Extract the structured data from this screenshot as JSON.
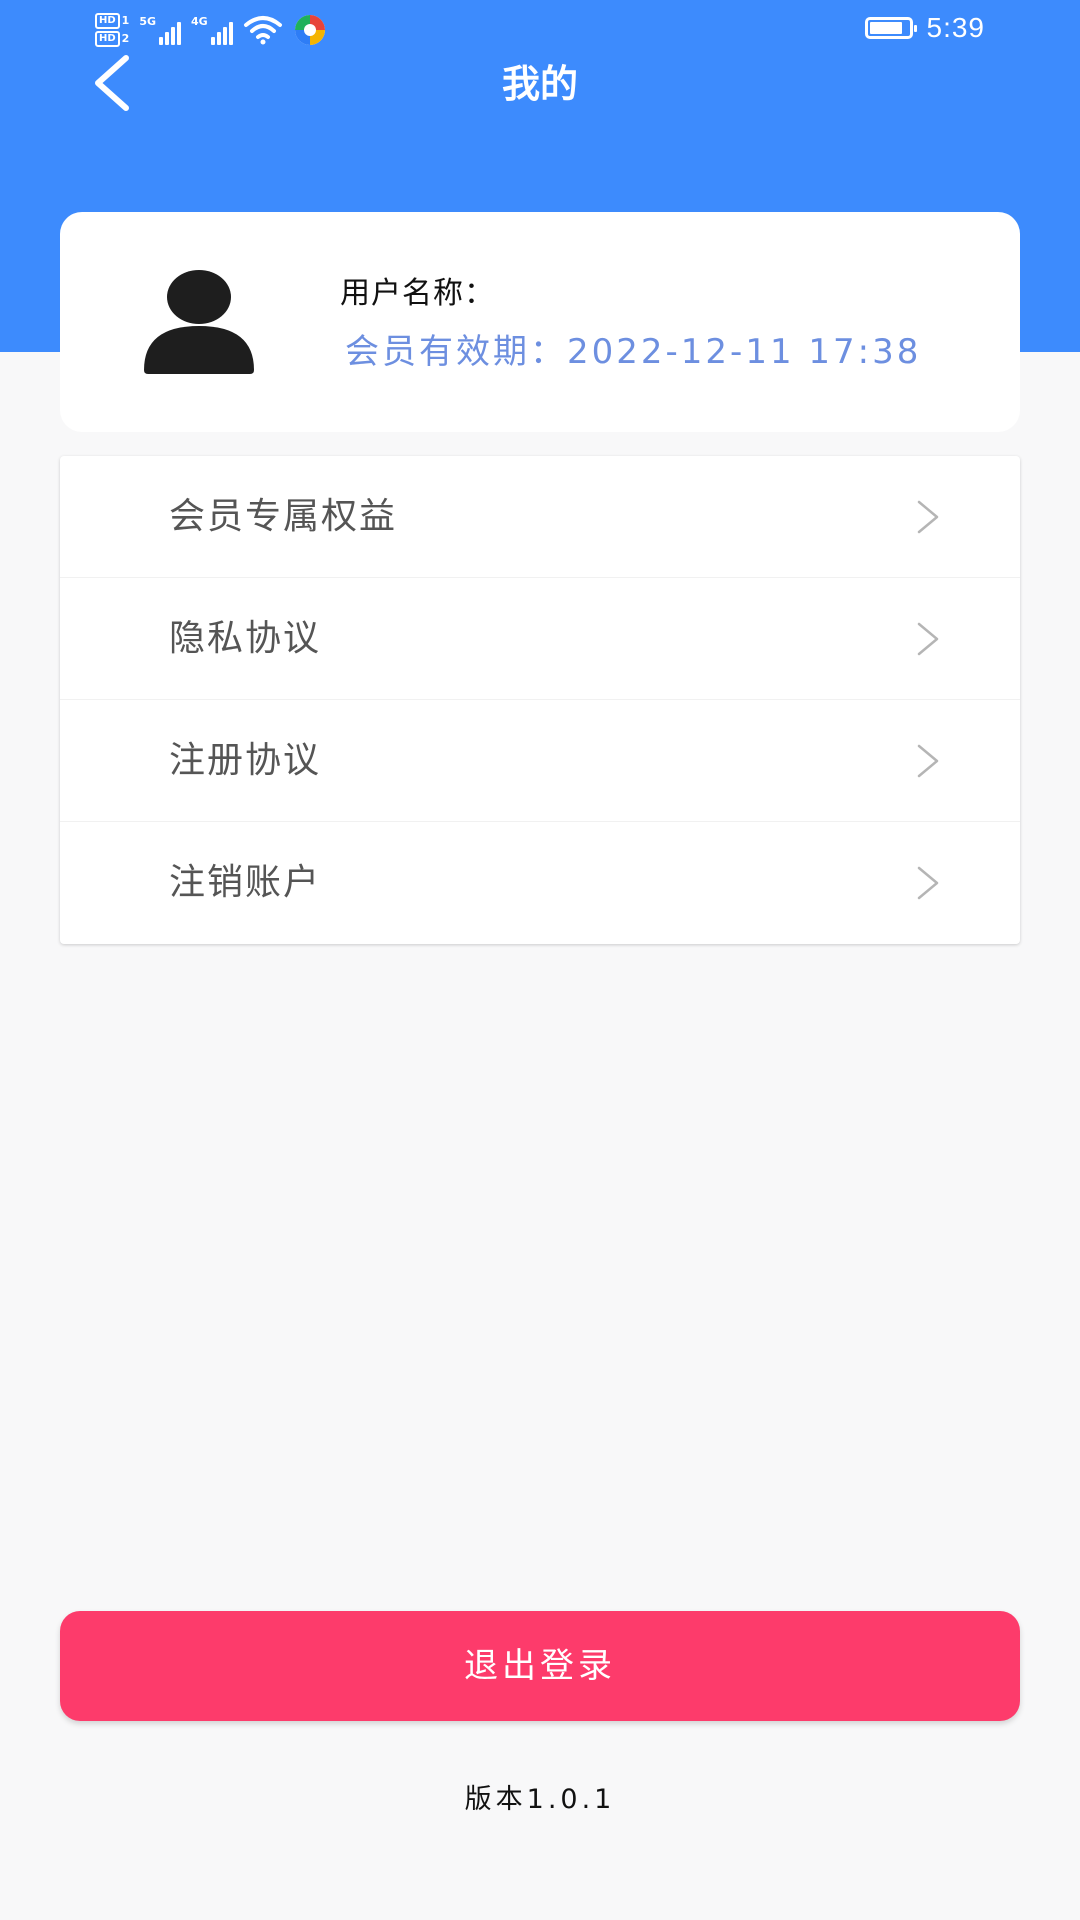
{
  "status_bar": {
    "sim1_badge": "HD",
    "sim1_index": "1",
    "sim2_badge": "HD",
    "sim2_index": "2",
    "network1": "5G",
    "network2": "4G",
    "battery_level": 0.85,
    "time": "5:39"
  },
  "header": {
    "title": "我的",
    "back_icon": "chevron-left-icon",
    "background_color": "#3d8bfd"
  },
  "profile": {
    "avatar_icon": "user-silhouette-icon",
    "username_label": "用户名称：",
    "expiry_text": "会员有效期：2022-12-11 17:38",
    "expiry_color": "#6d8fe0"
  },
  "menu": {
    "items": [
      {
        "label": "会员专属权益"
      },
      {
        "label": "隐私协议"
      },
      {
        "label": "注册协议"
      },
      {
        "label": "注销账户"
      }
    ],
    "chevron_icon": "chevron-right-icon"
  },
  "logout": {
    "label": "退出登录",
    "color": "#fd3b6b"
  },
  "footer": {
    "version": "版本1.0.1"
  }
}
